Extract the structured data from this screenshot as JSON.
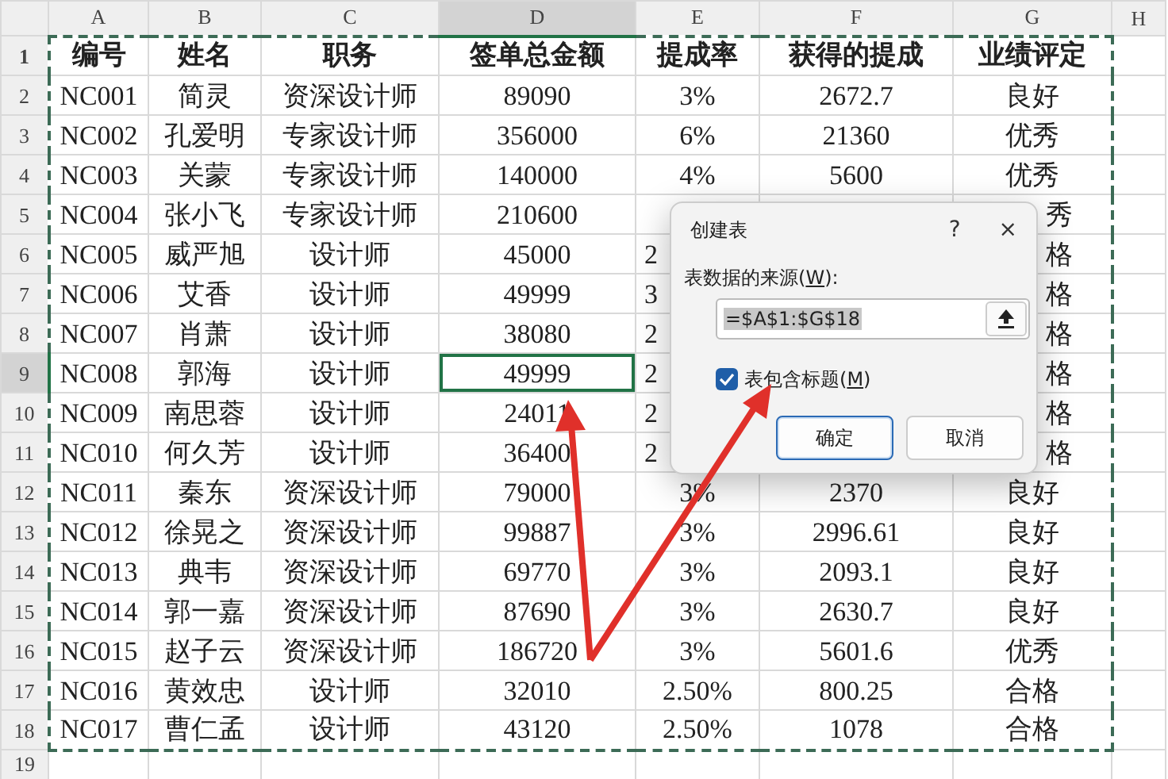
{
  "columns": [
    {
      "label": "A",
      "selected": false
    },
    {
      "label": "B",
      "selected": false
    },
    {
      "label": "C",
      "selected": false
    },
    {
      "label": "D",
      "selected": true
    },
    {
      "label": "E",
      "selected": false
    },
    {
      "label": "F",
      "selected": false
    },
    {
      "label": "G",
      "selected": false
    },
    {
      "label": "H",
      "selected": false
    }
  ],
  "rows": [
    {
      "number": "1",
      "selected": false,
      "kind": "header",
      "cells": {
        "A": "编号",
        "B": "姓名",
        "C": "职务",
        "D": "签单总金额",
        "E": "提成率",
        "F": "获得的提成",
        "G": "业绩评定"
      }
    },
    {
      "number": "2",
      "selected": false,
      "kind": "data",
      "cells": {
        "A": "NC001",
        "B": "简灵",
        "C": "资深设计师",
        "D": "89090",
        "E": "3%",
        "F": "2672.7",
        "G": "良好"
      }
    },
    {
      "number": "3",
      "selected": false,
      "kind": "data",
      "cells": {
        "A": "NC002",
        "B": "孔爱明",
        "C": "专家设计师",
        "D": "356000",
        "E": "6%",
        "F": "21360",
        "G": "优秀"
      }
    },
    {
      "number": "4",
      "selected": false,
      "kind": "data",
      "cells": {
        "A": "NC003",
        "B": "关蒙",
        "C": "专家设计师",
        "D": "140000",
        "E": "4%",
        "F": "5600",
        "G": "优秀"
      }
    },
    {
      "number": "5",
      "selected": false,
      "kind": "data",
      "cells": {
        "A": "NC004",
        "B": "张小飞",
        "C": "专家设计师",
        "D": "210600",
        "G": {
          "text": "秀",
          "left_hidden": true
        }
      }
    },
    {
      "number": "6",
      "selected": false,
      "kind": "data",
      "cells": {
        "A": "NC005",
        "B": "威严旭",
        "C": "设计师",
        "D": "45000",
        "E": {
          "text": "2",
          "right_hidden": true
        },
        "G": {
          "text": "格",
          "left_hidden": true
        }
      }
    },
    {
      "number": "7",
      "selected": false,
      "kind": "data",
      "cells": {
        "A": "NC006",
        "B": "艾香",
        "C": "设计师",
        "D": "49999",
        "E": {
          "text": "3",
          "right_hidden": true
        },
        "G": {
          "text": "格",
          "left_hidden": true
        }
      }
    },
    {
      "number": "8",
      "selected": false,
      "kind": "data",
      "cells": {
        "A": "NC007",
        "B": "肖萧",
        "C": "设计师",
        "D": "38080",
        "E": {
          "text": "2",
          "right_hidden": true
        },
        "G": {
          "text": "格",
          "left_hidden": true
        }
      }
    },
    {
      "number": "9",
      "selected": true,
      "kind": "data",
      "cells": {
        "A": "NC008",
        "B": "郭海",
        "C": "设计师",
        "D": "49999",
        "E": {
          "text": "2",
          "right_hidden": true
        },
        "G": {
          "text": "格",
          "left_hidden": true
        }
      }
    },
    {
      "number": "10",
      "selected": false,
      "kind": "data",
      "cells": {
        "A": "NC009",
        "B": "南思蓉",
        "C": "设计师",
        "D": "24011",
        "E": {
          "text": "2",
          "right_hidden": true
        },
        "G": {
          "text": "格",
          "left_hidden": true
        }
      }
    },
    {
      "number": "11",
      "selected": false,
      "kind": "data",
      "cells": {
        "A": "NC010",
        "B": "何久芳",
        "C": "设计师",
        "D": "36400",
        "E": {
          "text": "2",
          "right_hidden": true
        },
        "G": {
          "text": "格",
          "left_hidden": true
        }
      }
    },
    {
      "number": "12",
      "selected": false,
      "kind": "data",
      "cells": {
        "A": "NC011",
        "B": "秦东",
        "C": "资深设计师",
        "D": "79000",
        "E": "3%",
        "F": "2370",
        "G": "良好"
      }
    },
    {
      "number": "13",
      "selected": false,
      "kind": "data",
      "cells": {
        "A": "NC012",
        "B": "徐晃之",
        "C": "资深设计师",
        "D": "99887",
        "E": "3%",
        "F": "2996.61",
        "G": "良好"
      }
    },
    {
      "number": "14",
      "selected": false,
      "kind": "data",
      "cells": {
        "A": "NC013",
        "B": "典韦",
        "C": "资深设计师",
        "D": "69770",
        "E": "3%",
        "F": "2093.1",
        "G": "良好"
      }
    },
    {
      "number": "15",
      "selected": false,
      "kind": "data",
      "cells": {
        "A": "NC014",
        "B": "郭一嘉",
        "C": "资深设计师",
        "D": "87690",
        "E": "3%",
        "F": "2630.7",
        "G": "良好"
      }
    },
    {
      "number": "16",
      "selected": false,
      "kind": "data",
      "cells": {
        "A": "NC015",
        "B": "赵子云",
        "C": "资深设计师",
        "D": "186720",
        "E": "3%",
        "F": "5601.6",
        "G": "优秀"
      }
    },
    {
      "number": "17",
      "selected": false,
      "kind": "data",
      "cells": {
        "A": "NC016",
        "B": "黄效忠",
        "C": "设计师",
        "D": "32010",
        "E": "2.50%",
        "F": "800.25",
        "G": "合格"
      }
    },
    {
      "number": "18",
      "selected": false,
      "kind": "data",
      "cells": {
        "A": "NC017",
        "B": "曹仁孟",
        "C": "设计师",
        "D": "43120",
        "E": "2.50%",
        "F": "1078",
        "G": "合格"
      }
    },
    {
      "number": "19",
      "selected": false,
      "kind": "data"
    }
  ],
  "dialog": {
    "title": "创建表",
    "help": "?",
    "close": "×",
    "source_label": {
      "before": "表数据的来源(",
      "access_key": "W",
      "after": "):"
    },
    "source_value": "=$A$1:$G$18",
    "source_text_selected": true,
    "checkbox": {
      "before": "表包含标题(",
      "access_key": "M",
      "after": ")",
      "checked": true
    },
    "buttons": [
      {
        "label": "确定",
        "default": true
      },
      {
        "label": "取消",
        "default": false
      }
    ]
  }
}
